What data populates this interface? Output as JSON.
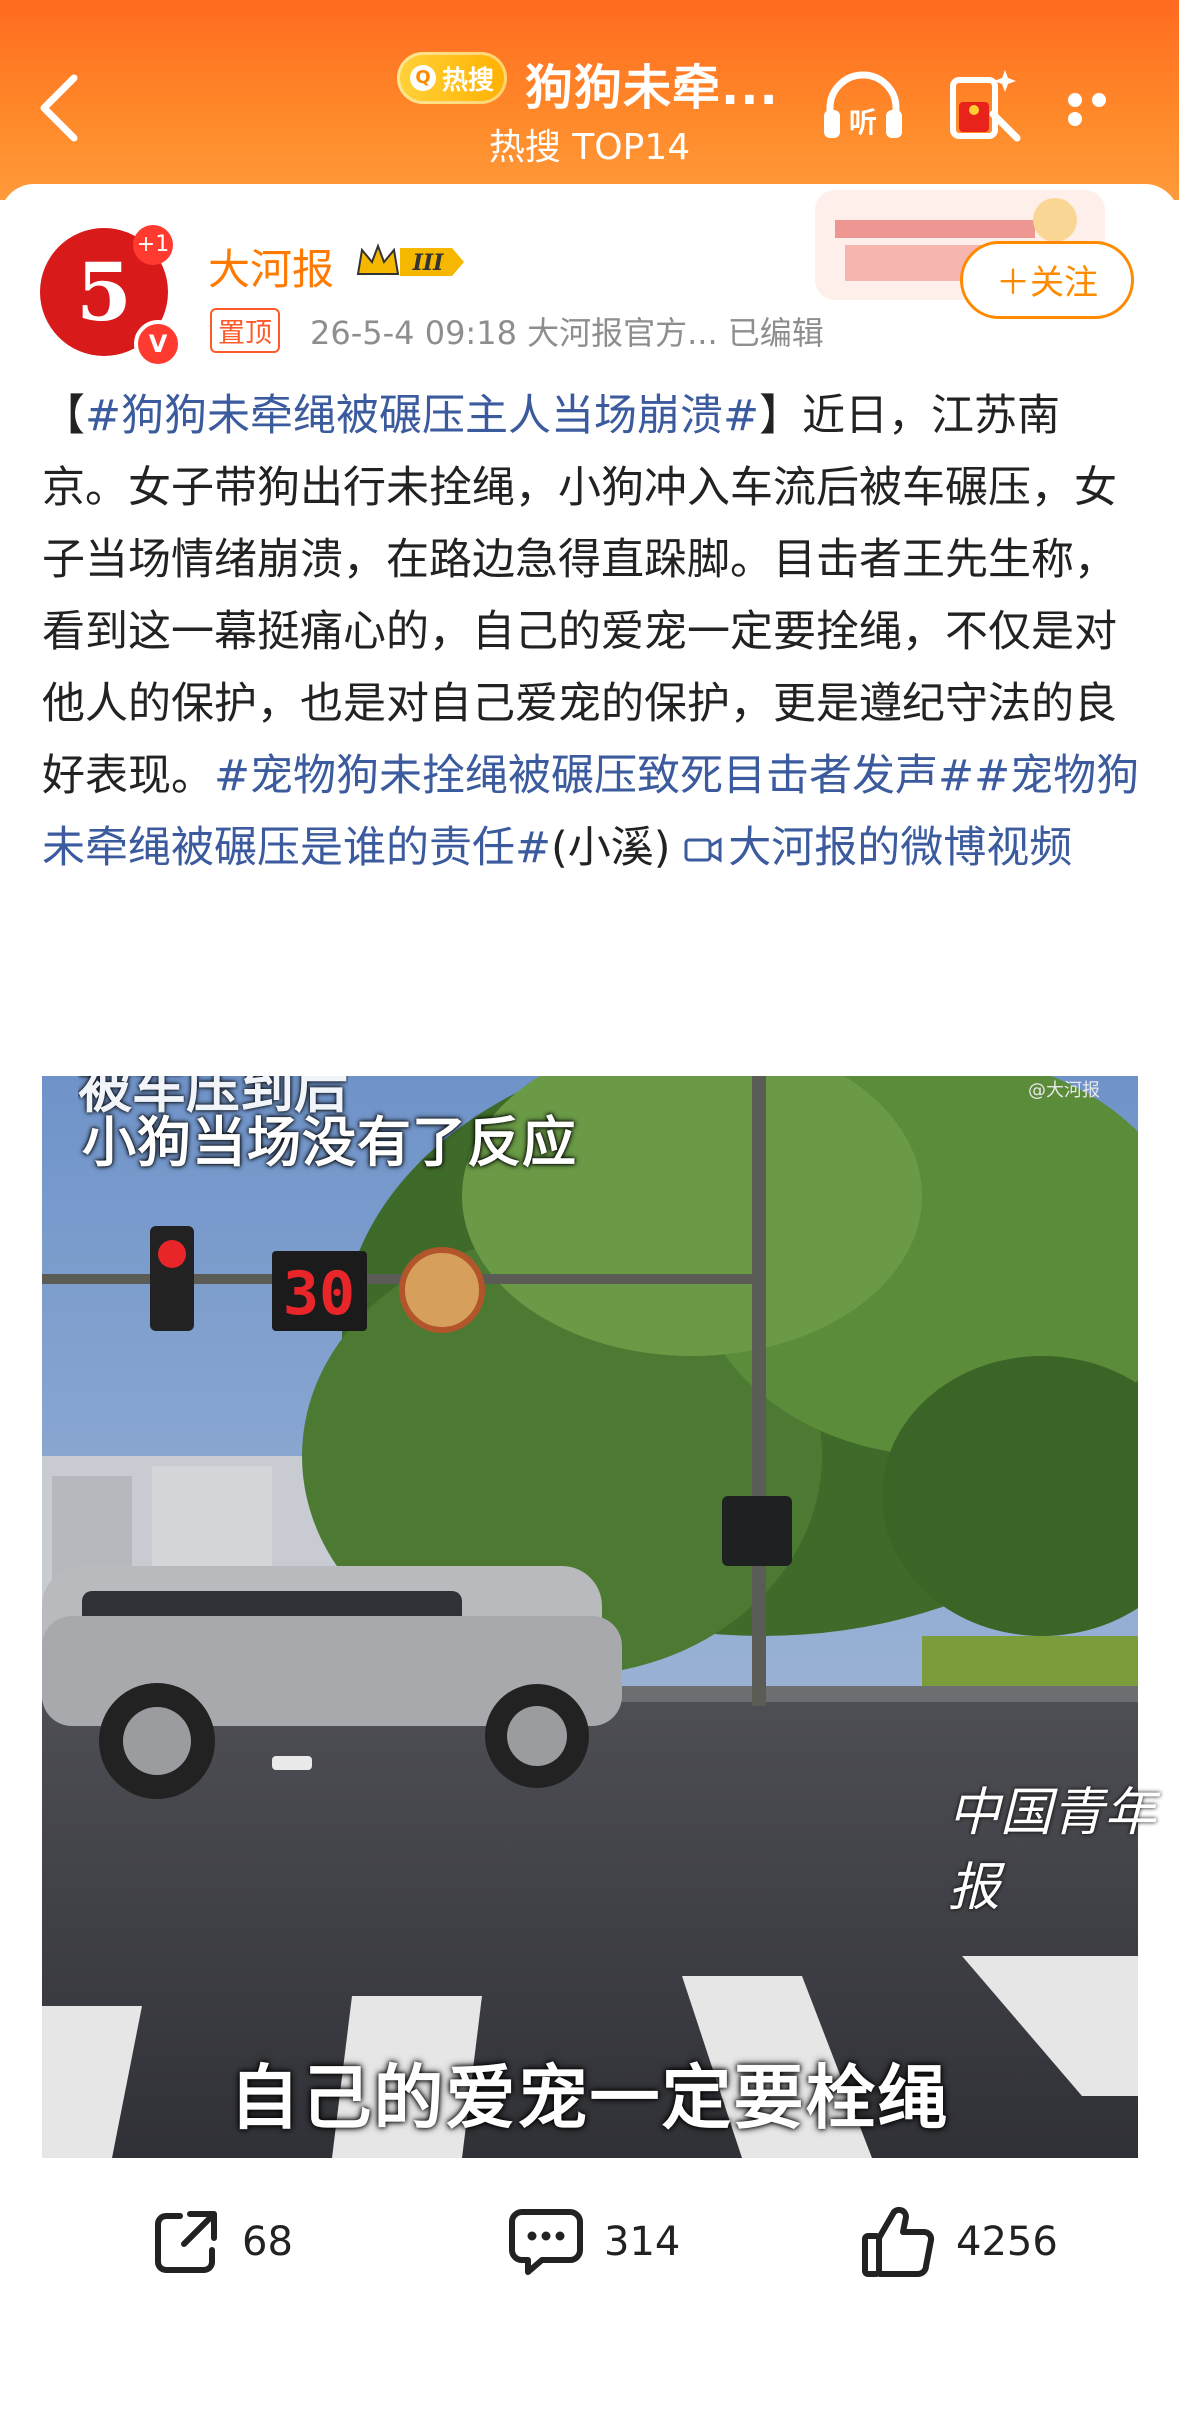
{
  "header": {
    "hot_badge": "热搜",
    "title": "狗狗未牵...",
    "subtitle": "热搜 TOP14",
    "listen_label": "听"
  },
  "post": {
    "author": "大河报",
    "avatar_char": "5",
    "avatar_plus": "+1",
    "verified_mark": "V",
    "level": "III",
    "pinned_label": "置顶",
    "meta": "26-5-4 09:18  大河报官方...  已编辑",
    "follow_label": "＋关注",
    "text": {
      "tag1": "#狗狗未牵绳被碾压主人当场崩溃#",
      "bracket_open": "【",
      "bracket_close": "】",
      "main": "近日，江苏南京。女子带狗出行未拴绳，小狗冲入车流后被车碾压，女子当场情绪崩溃，在路边急得直跺脚。目击者王先生称，看到这一幕挺痛心的，自己的爱宠一定要拴绳，不仅是对他人的保护，也是对自己爱宠的保护，更是遵纪守法的良好表现。",
      "tag2": "#宠物狗未拴绳被碾压致死目击者发声#",
      "tag3": "#宠物狗未牵绳被碾压是谁的责任#",
      "suffix": "(小溪) ",
      "video_link": "大河报的微博视频"
    }
  },
  "video": {
    "overlay_line1": "被车压到后",
    "overlay_line2": "小狗当场没有了反应",
    "caption": "自己的爱宠一定要栓绳",
    "watermark_small": "@大河报",
    "watermark_brand": "中国青年报",
    "signal_number": "30"
  },
  "actions": {
    "repost_count": "68",
    "comment_count": "314",
    "like_count": "4256"
  },
  "colors": {
    "header_orange": "#ff6a1f",
    "accent": "#ff8a00",
    "link_blue": "#3b5b9e"
  }
}
